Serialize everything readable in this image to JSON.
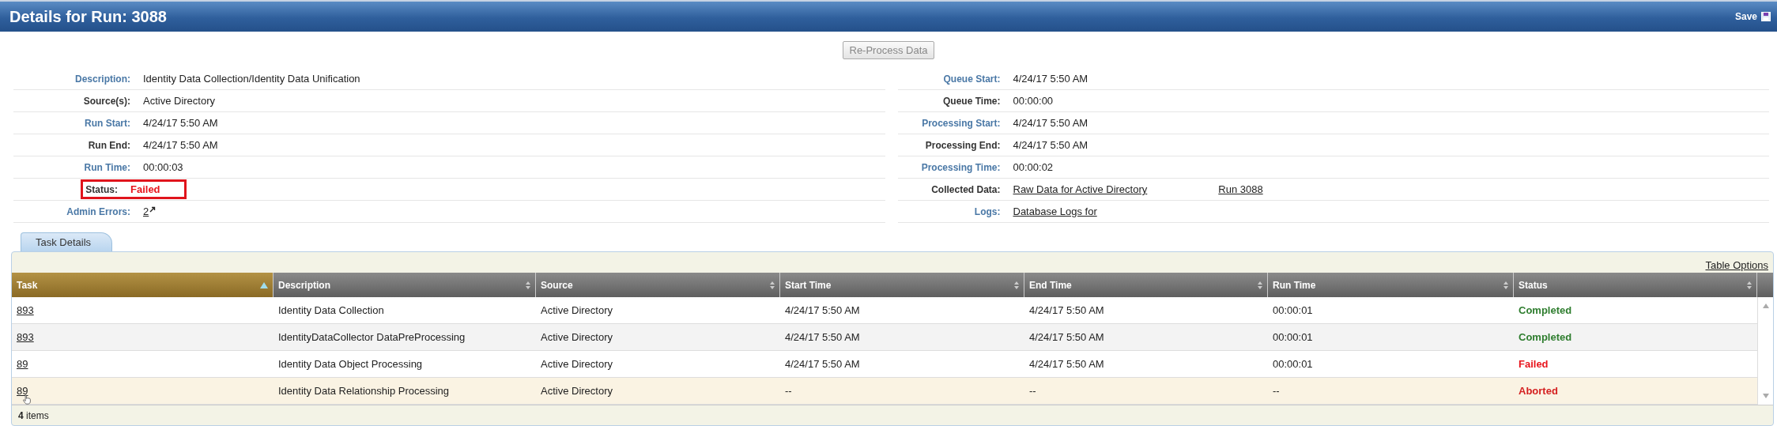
{
  "window": {
    "title": "Details for Run: 3088",
    "save_label": "Save"
  },
  "reprocess_button": {
    "label": "Re-Process Data",
    "disabled": true
  },
  "details_left": [
    {
      "label": "Description:",
      "color": "#4a78a6",
      "kind": "text",
      "value": "Identity Data Collection/Identity Data Unification"
    },
    {
      "label": "Source(s):",
      "color": "#333333",
      "kind": "text",
      "value": "Active Directory"
    },
    {
      "label": "Run Start:",
      "color": "#4a78a6",
      "kind": "text",
      "value": "4/24/17 5:50 AM"
    },
    {
      "label": "Run End:",
      "color": "#333333",
      "kind": "text",
      "value": "4/24/17 5:50 AM"
    },
    {
      "label": "Run Time:",
      "color": "#4a78a6",
      "kind": "text",
      "value": "00:00:03"
    },
    {
      "label": "Status:",
      "color": "#333333",
      "kind": "status",
      "value": "Failed",
      "outlined": true
    },
    {
      "label": "Admin Errors:",
      "color": "#4a78a6",
      "kind": "count_link",
      "value": "2"
    }
  ],
  "details_right": [
    {
      "label": "Queue Start:",
      "color": "#4a78a6",
      "kind": "text",
      "value": "4/24/17 5:50 AM"
    },
    {
      "label": "Queue Time:",
      "color": "#333333",
      "kind": "text",
      "value": "00:00:00"
    },
    {
      "label": "Processing Start:",
      "color": "#4a78a6",
      "kind": "text",
      "value": "4/24/17 5:50 AM"
    },
    {
      "label": "Processing End:",
      "color": "#333333",
      "kind": "text",
      "value": "4/24/17 5:50 AM"
    },
    {
      "label": "Processing Time:",
      "color": "#4a78a6",
      "kind": "text",
      "value": "00:00:02"
    },
    {
      "label": "Collected Data:",
      "color": "#333333",
      "kind": "links",
      "links": [
        "Raw Data for Active Directory",
        "Run 3088"
      ]
    },
    {
      "label": "Logs:",
      "color": "#4a78a6",
      "kind": "links",
      "links": [
        "Database Logs for"
      ]
    }
  ],
  "tabs": [
    {
      "label": "Task Details",
      "selected": true
    }
  ],
  "table_options": "Table Options",
  "columns": [
    {
      "label": "Task",
      "sorted": true
    },
    {
      "label": "Description",
      "sorted": false
    },
    {
      "label": "Source",
      "sorted": false
    },
    {
      "label": "Start Time",
      "sorted": false
    },
    {
      "label": "End Time",
      "sorted": false
    },
    {
      "label": "Run Time",
      "sorted": false
    },
    {
      "label": "Status",
      "sorted": false
    }
  ],
  "rows": [
    {
      "task": "893",
      "description": "Identity Data Collection",
      "source": "Active Directory",
      "start_time": "4/24/17 5:50 AM",
      "end_time": "4/24/17 5:50 AM",
      "run_time": "00:00:01",
      "status": "Completed",
      "color": "#2e7d2e",
      "hovered": false
    },
    {
      "task": "893",
      "description": "IdentityDataCollector DataPreProcessing",
      "source": "Active Directory",
      "start_time": "4/24/17 5:50 AM",
      "end_time": "4/24/17 5:50 AM",
      "run_time": "00:00:01",
      "status": "Completed",
      "color": "#2e7d2e",
      "hovered": false
    },
    {
      "task": "89",
      "description": "Identity Data Object Processing",
      "source": "Active Directory",
      "start_time": "4/24/17 5:50 AM",
      "end_time": "4/24/17 5:50 AM",
      "run_time": "00:00:01",
      "status": "Failed",
      "color": "#e8141c",
      "hovered": false
    },
    {
      "task": "89",
      "description": "Identity Data Relationship Processing",
      "source": "Active Directory",
      "start_time": "--",
      "end_time": "--",
      "run_time": "--",
      "status": "Aborted",
      "color": "#d42020",
      "hovered": true
    }
  ],
  "footer": "**4** items"
}
